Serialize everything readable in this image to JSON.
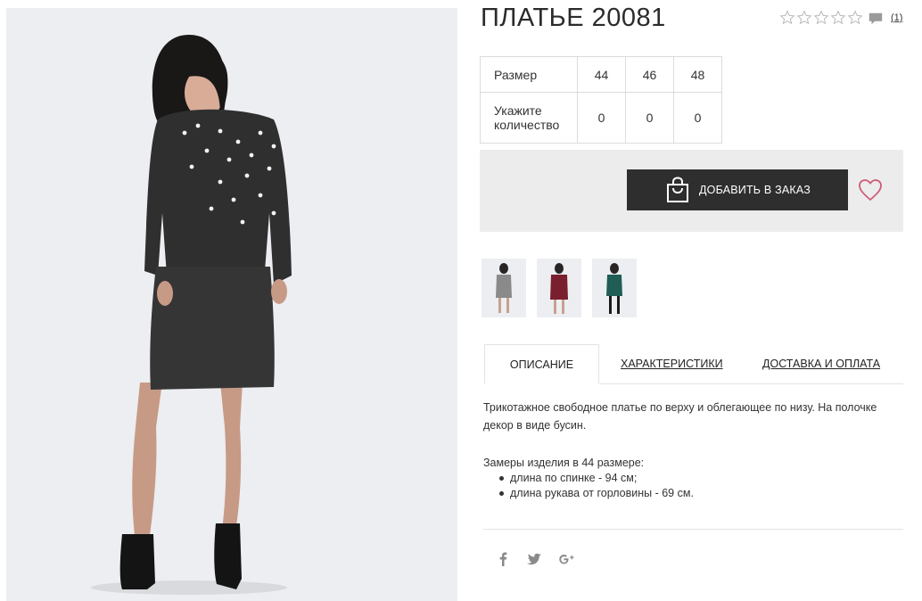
{
  "product": {
    "title": "ПЛАТЬЕ 20081",
    "rating_stars": 5,
    "rating_filled": 0,
    "reviews_count": "(1)"
  },
  "size_table": {
    "size_label": "Размер",
    "sizes": [
      "44",
      "46",
      "48"
    ],
    "qty_label": "Укажите количество",
    "quantities": [
      "0",
      "0",
      "0"
    ]
  },
  "order": {
    "add_button_label": "ДОБАВИТЬ В ЗАКАЗ"
  },
  "thumbnails": [
    {
      "color_name": "grey",
      "color": "#8a8a8a"
    },
    {
      "color_name": "burgundy",
      "color": "#7a1f2e"
    },
    {
      "color_name": "green",
      "color": "#1f5d55"
    }
  ],
  "tabs": {
    "description": "ОПИСАНИЕ",
    "characteristics": "ХАРАКТЕРИСТИКИ",
    "delivery": "ДОСТАВКА И ОПЛАТА"
  },
  "description": {
    "text": "Трикотажное свободное платье по верху и облегающее по низу. На полочке декор в виде бусин.",
    "measures_title": "Замеры изделия в 44 размере:",
    "measures": [
      "длина по спинке - 94 см;",
      "длина рукава от горловины - 69 см."
    ]
  },
  "social": [
    "facebook-icon",
    "twitter-icon",
    "google-plus-icon"
  ],
  "colors": {
    "button_bg": "#2e2e2e",
    "heart": "#d05a76",
    "dress_main": "#2f2f30"
  }
}
